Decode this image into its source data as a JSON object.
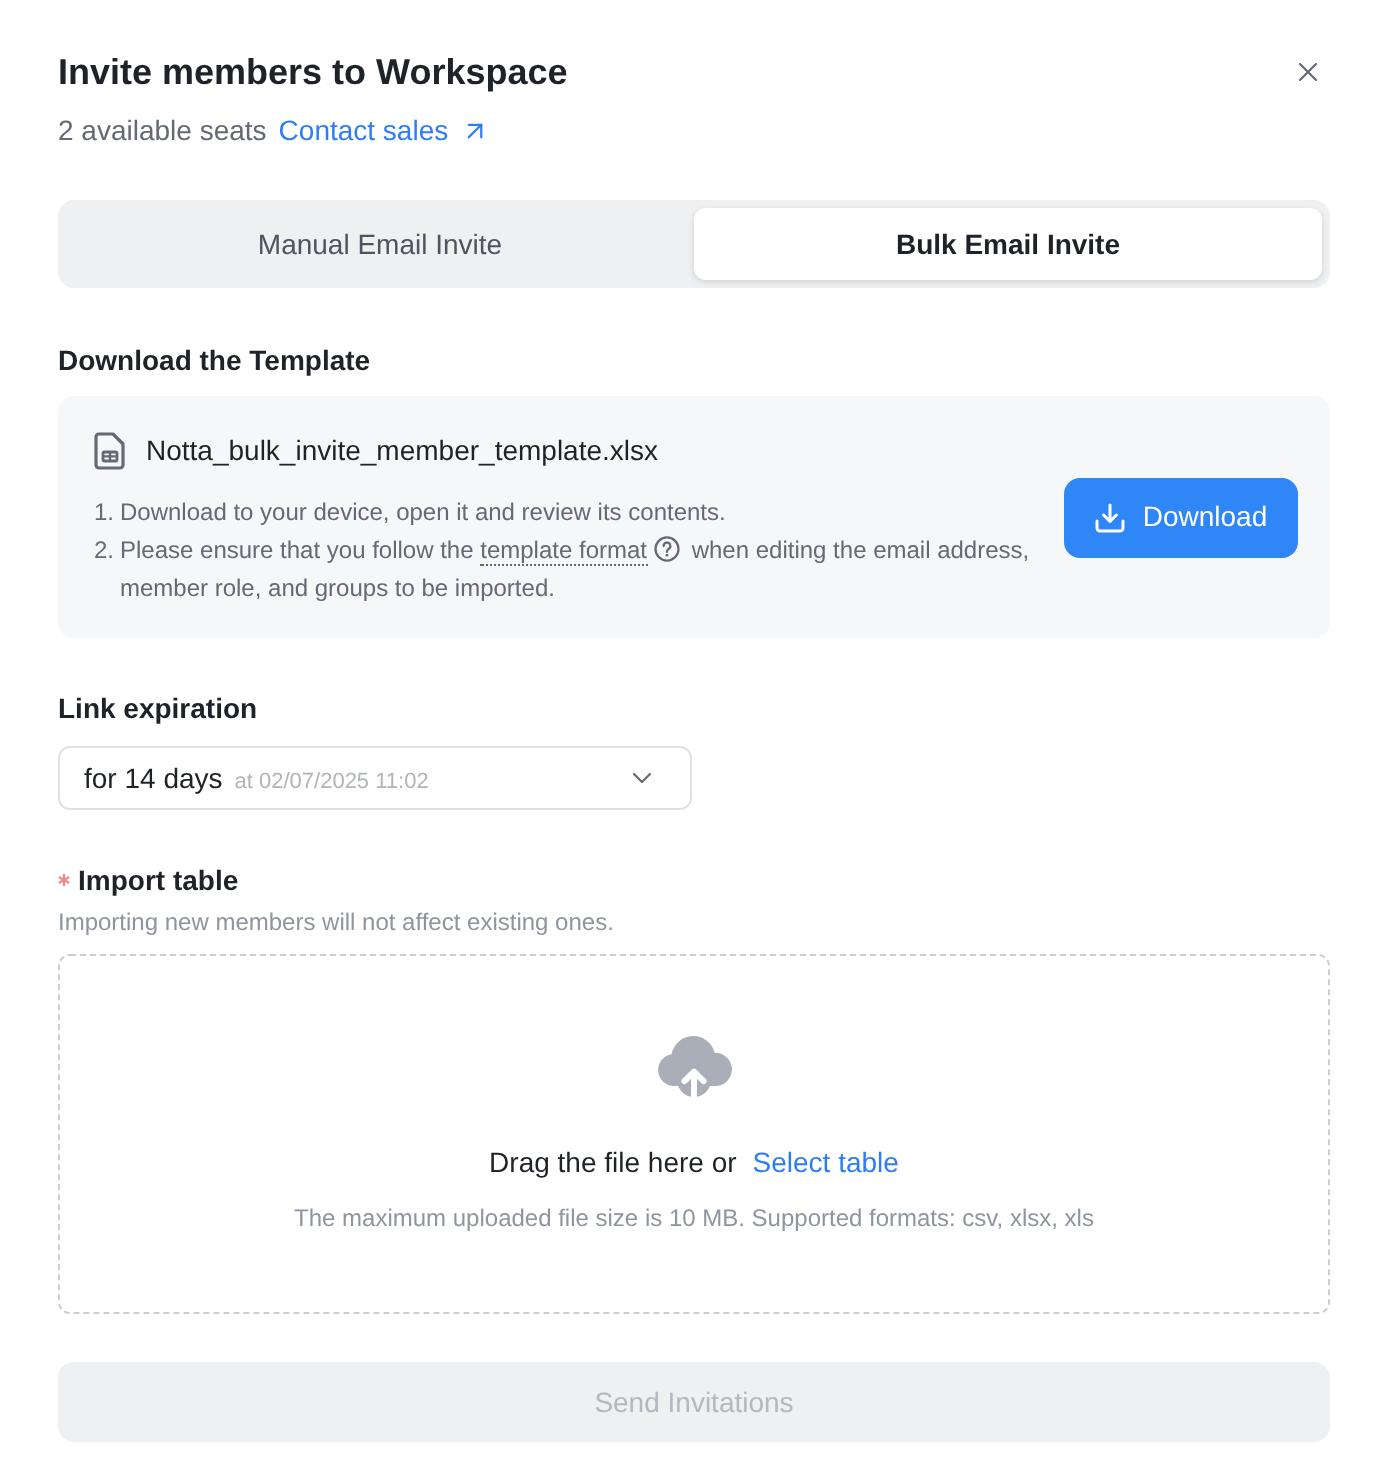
{
  "dialog": {
    "title": "Invite members to Workspace",
    "seats": "2 available seats",
    "contact_link": "Contact sales"
  },
  "tabs": [
    {
      "label": "Manual Email Invite",
      "selected": false
    },
    {
      "label": "Bulk Email Invite",
      "selected": true
    }
  ],
  "template": {
    "heading": "Download the Template",
    "file_name": "Notta_bulk_invite_member_template.xlsx",
    "steps": [
      {
        "number": "1.",
        "text": "Download to your device, open it and review its contents."
      },
      {
        "number": "2.",
        "text": "Please ensure that you follow the",
        "link": "template format",
        "text_after": "when editing the email address, member role, and groups to be imported."
      }
    ],
    "button": "Download"
  },
  "expiration": {
    "label": "Link expiration",
    "value": "for 14 days",
    "detail": "at 02/07/2025 11:02"
  },
  "import": {
    "label": "Import table",
    "required": true,
    "hint": "Importing new members will not affect existing ones.",
    "drop_text": "Drag the file here or",
    "select_link": "Select table",
    "limits": "The maximum uploaded file size is 10 MB. Supported formats: csv, xlsx, xls"
  },
  "submit": {
    "label": "Send Invitations",
    "disabled": true
  }
}
